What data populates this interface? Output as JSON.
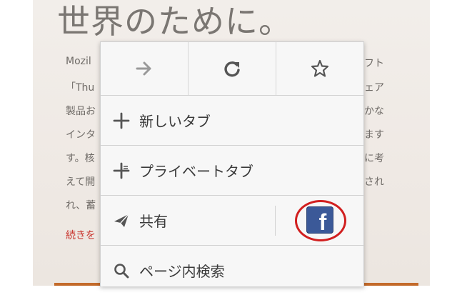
{
  "page": {
    "heading": "世界のために。",
    "left_fragments": [
      "Mozil",
      "「Thu",
      "製品お",
      "インタ",
      "す。核",
      "えて開",
      "れ、蓄"
    ],
    "right_fragments": [
      "フト",
      "フェア",
      "豊かな",
      "ています",
      "ーに考",
      "用され"
    ],
    "continue_link": "続きを"
  },
  "menu": {
    "toolbar": [
      {
        "name": "forward",
        "icon": "arrow-right-icon"
      },
      {
        "name": "reload",
        "icon": "reload-icon"
      },
      {
        "name": "bookmark",
        "icon": "star-icon"
      }
    ],
    "items": [
      {
        "label": "新しいタブ",
        "icon": "plus-icon"
      },
      {
        "label": "プライベートタブ",
        "icon": "private-plus-icon"
      },
      {
        "label": "共有",
        "icon": "share-icon"
      },
      {
        "label": "ページ内検索",
        "icon": "search-icon"
      }
    ],
    "share_target": {
      "icon": "facebook-icon",
      "glyph": "f",
      "color": "#3b5998",
      "highlight": "#d11f1f"
    }
  }
}
